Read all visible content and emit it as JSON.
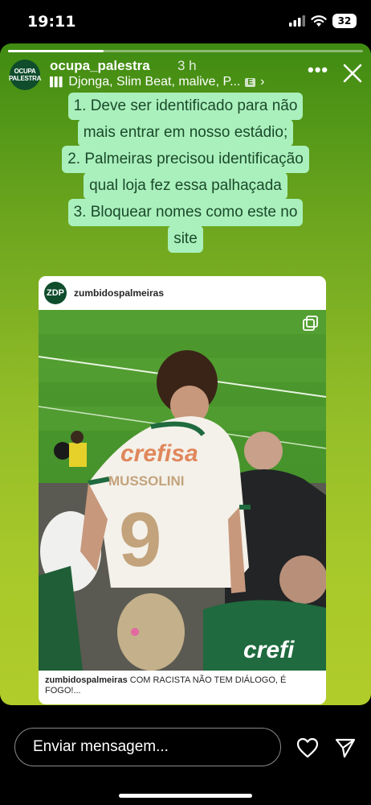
{
  "status_bar": {
    "time": "19:11",
    "battery": "32"
  },
  "story": {
    "progress": 0.27,
    "avatar_text": [
      "OCUPA",
      "PALESTRA"
    ],
    "username": "ocupa_palestra",
    "time_ago": "3 h",
    "music": "Djonga, Slim Beat, malive, P...",
    "explicit_badge": "E",
    "caption_lines": [
      "1. Deve ser identificado para não",
      "mais entrar em nosso estádio;",
      "2. Palmeiras precisou identificação",
      "qual loja fez essa palhaçada",
      "3. Bloquear nomes como este no",
      "site"
    ]
  },
  "post": {
    "username": "zumbidospalmeiras",
    "avatar_text": "ZDP",
    "jersey_sponsor": "crefisa",
    "jersey_name": "MUSSOLINI",
    "jersey_number": "9",
    "caption_username": "zumbidospalmeiras",
    "caption_text": "COM RACISTA NÃO TEM DIÁLOGO, É FOGO!..."
  },
  "reply": {
    "placeholder": "Enviar mensagem..."
  },
  "colors": {
    "story_green": "#6aa41e",
    "caption_bg": "#aaf0bc",
    "caption_text": "#1a4a2a"
  }
}
